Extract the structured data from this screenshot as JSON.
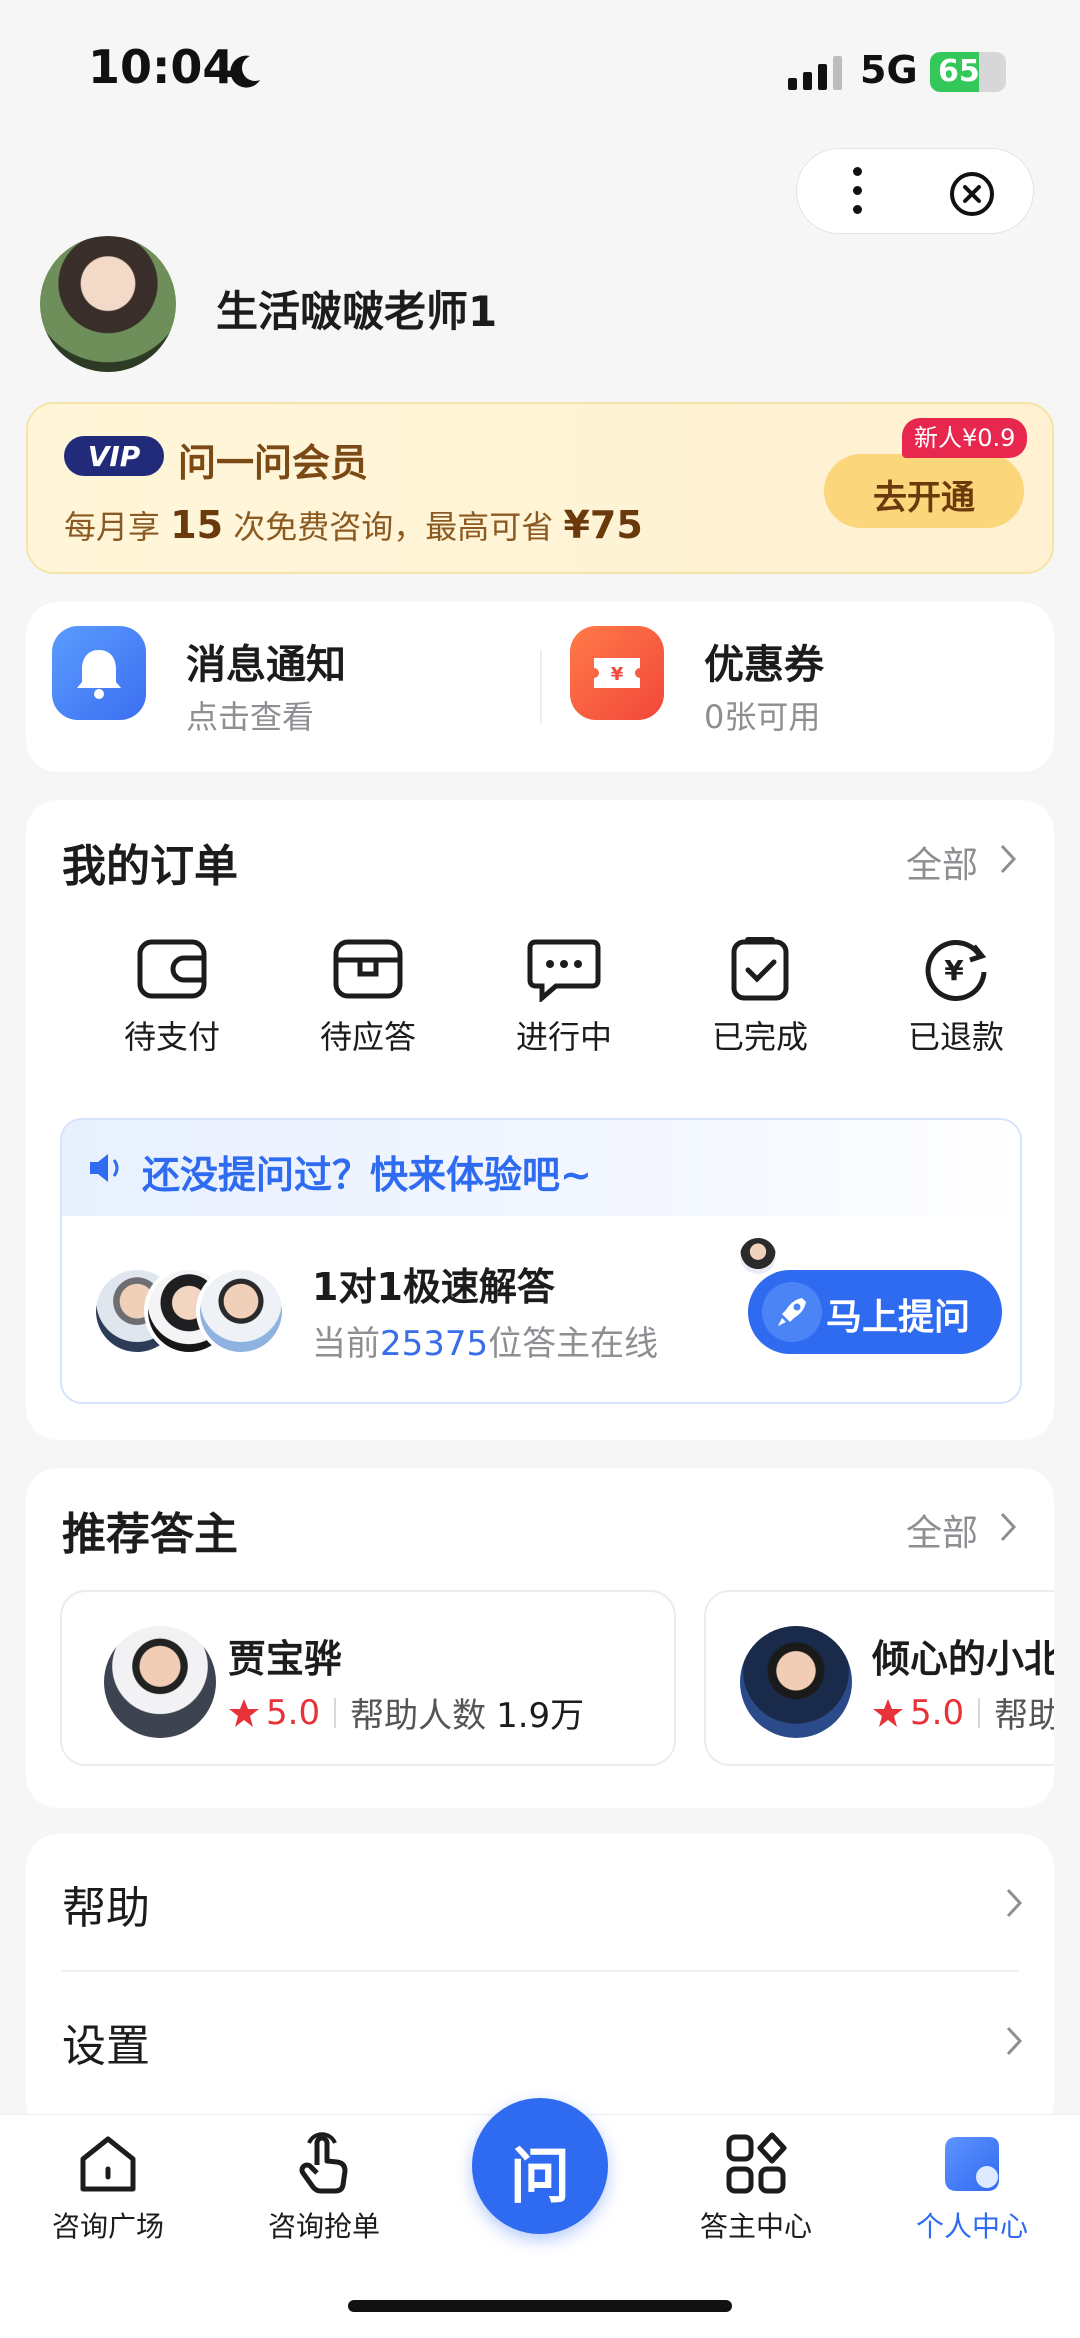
{
  "status_bar": {
    "time": "10:04",
    "network": "5G",
    "battery": "65",
    "battery_level": 0.65
  },
  "profile": {
    "name": "生活啵啵老师1"
  },
  "vip": {
    "badge": "VIP",
    "title": "问一问会员",
    "desc_prefix": "每月享",
    "free_count": "15",
    "desc_middle": "次免费咨询，最高可省",
    "save_amount": "¥75",
    "button": "去开通",
    "tag": "新人¥0.9"
  },
  "quick": [
    {
      "title": "消息通知",
      "subtitle": "点击查看",
      "icon": "bell-icon",
      "color": "#4a86f7"
    },
    {
      "title": "优惠券",
      "subtitle": "0张可用",
      "icon": "coupon-icon",
      "color": "#f5553a"
    }
  ],
  "orders": {
    "title": "我的订单",
    "more": "全部",
    "items": [
      {
        "label": "待支付",
        "icon": "wallet-icon"
      },
      {
        "label": "待应答",
        "icon": "inbox-icon"
      },
      {
        "label": "进行中",
        "icon": "chat-icon"
      },
      {
        "label": "已完成",
        "icon": "clipboard-check-icon"
      },
      {
        "label": "已退款",
        "icon": "refund-icon"
      }
    ]
  },
  "promo": {
    "headline": "还没提问过？快来体验吧~",
    "title": "1对1极速解答",
    "online_prefix": "当前",
    "online_count": "25375",
    "online_suffix": "位答主在线",
    "button": "马上提问"
  },
  "recommend": {
    "title": "推荐答主",
    "more": "全部",
    "experts": [
      {
        "name": "贾宝骅",
        "rating": "5.0",
        "help_label": "帮助人数",
        "help_count": "1.9万"
      },
      {
        "name": "倾心的小北",
        "rating": "5.0",
        "help_label": "帮助人数",
        "help_count": ""
      }
    ]
  },
  "menu": [
    {
      "label": "帮助"
    },
    {
      "label": "设置"
    }
  ],
  "tabbar": {
    "tabs": [
      {
        "label": "咨询广场",
        "icon": "home-icon"
      },
      {
        "label": "咨询抢单",
        "icon": "tap-hand-icon"
      },
      {
        "label": "答主中心",
        "icon": "grid-icon"
      },
      {
        "label": "个人中心",
        "icon": "profile-icon"
      }
    ],
    "center": "问",
    "active_color": "#2f6bf0"
  }
}
